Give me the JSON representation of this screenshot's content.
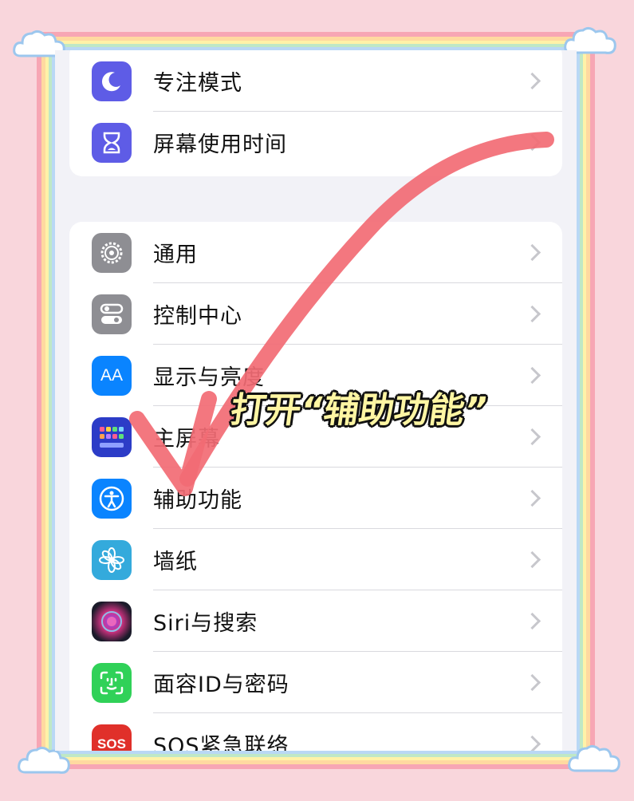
{
  "group1": [
    {
      "label": "专注模式",
      "icon": "moon-icon",
      "color": "#5e5ce6"
    },
    {
      "label": "屏幕使用时间",
      "icon": "hourglass-icon",
      "color": "#5e5ce6"
    }
  ],
  "group2": [
    {
      "label": "通用",
      "icon": "gear-icon",
      "color": "#8e8e93"
    },
    {
      "label": "控制中心",
      "icon": "toggles-icon",
      "color": "#8e8e93"
    },
    {
      "label": "显示与亮度",
      "icon": "text-size-icon",
      "color": "#0a84ff",
      "icon_text": "AA"
    },
    {
      "label": "主屏幕",
      "icon": "home-screen-icon",
      "color": "#2c3cc7"
    },
    {
      "label": "辅助功能",
      "icon": "accessibility-icon",
      "color": "#0a84ff"
    },
    {
      "label": "墙纸",
      "icon": "flower-icon",
      "color": "#34aadc"
    },
    {
      "label": "Siri与搜索",
      "icon": "siri-icon",
      "color": "#222"
    },
    {
      "label": "面容ID与密码",
      "icon": "face-id-icon",
      "color": "#30d158"
    },
    {
      "label": "SOS紧急联络",
      "icon": "sos-icon",
      "color": "#e0302a",
      "icon_text": "SOS"
    }
  ],
  "annotation": {
    "text": "打开“辅助功能”",
    "arrow_color": "#f26b74"
  }
}
